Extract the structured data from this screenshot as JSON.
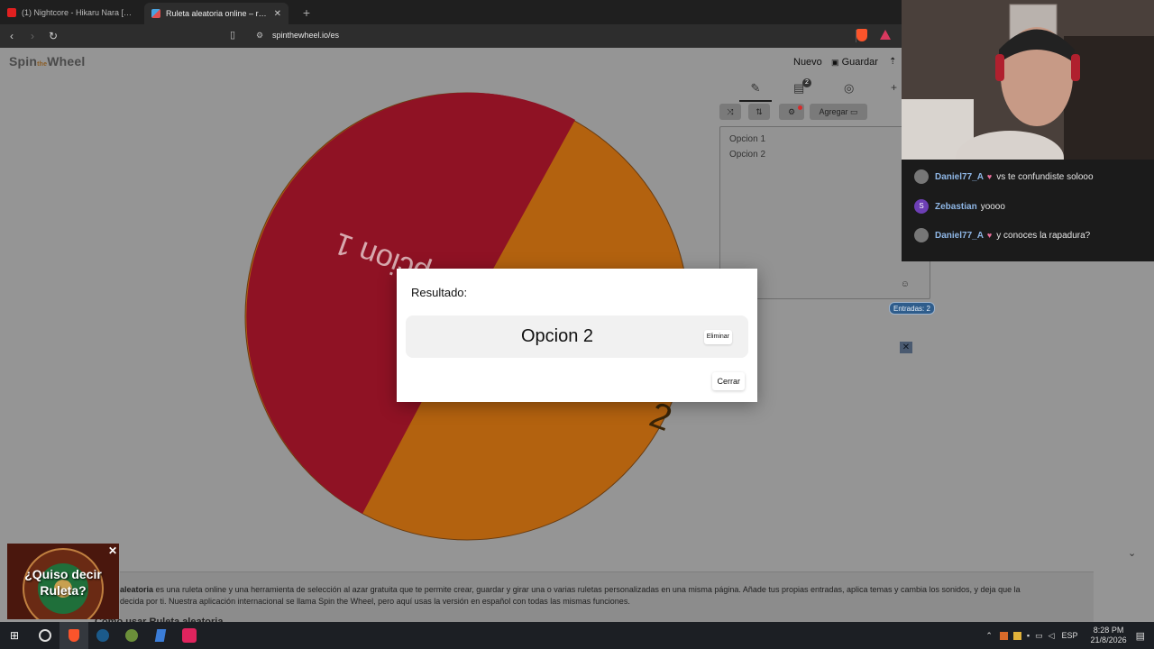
{
  "browser": {
    "tabs": [
      {
        "title": "(1) Nightcore - Hikaru Nara [Shig",
        "color": "#e02020"
      },
      {
        "title": "Ruleta aleatoria online – ruleta d",
        "color": "#4aa3e0"
      }
    ],
    "new_tab": "+",
    "url": "spinthewheel.io/es"
  },
  "page": {
    "logo_main": "Spin",
    "logo_accent": "the",
    "logo_end": "Wheel",
    "menu": {
      "new": "Nuevo",
      "save": "Guardar"
    },
    "editor_tabs": {
      "entries_badge": "2"
    },
    "tools": {
      "add": "Agregar"
    },
    "entries": [
      "Opcion 1",
      "Opcion 2"
    ],
    "entries_count": "Entradas: 2",
    "wheel": {
      "slices": [
        {
          "label": "Opcion 1",
          "color": "#8f1224"
        },
        {
          "label": "Opcion 2",
          "color": "#b3620f"
        }
      ],
      "visible_label_1": "Opcion 1",
      "visible_label_2": "2"
    },
    "description_bold": "aleatoria",
    "description_rest": " es una ruleta online y una herramienta de selección al azar gratuita que te permite crear, guardar y girar una o varias ruletas personalizadas en una misma página. Añade tus propias entradas, aplica temas y cambia los sonidos, y deja que la",
    "description_line2": "decida por ti. Nuestra aplicación internacional se llama Spin the Wheel, pero aquí usas la versión en español con todas las mismas funciones.",
    "subheading": "Cómo usar Ruleta aleatoria"
  },
  "modal": {
    "title": "Resultado:",
    "result": "Opcion 2",
    "delete_label": "Eliminar",
    "close_label": "Cerrar"
  },
  "chat": [
    {
      "user": "Daniel77_A",
      "badge": "♥",
      "message": "vs te confundiste solooo",
      "avatar_color": "#777777"
    },
    {
      "user": "Zebastian",
      "badge": "",
      "message": "yoooo",
      "avatar_color": "#6d3fb5",
      "initial": "S"
    },
    {
      "user": "Daniel77_A",
      "badge": "♥",
      "message": "y conoces la rapadura?",
      "avatar_color": "#777777"
    }
  ],
  "ad": {
    "text": "¿Quiso decir Ruleta?",
    "close": "✕"
  },
  "taskbar": {
    "lang": "ESP",
    "time": "8:28 PM",
    "date": "21/8/2026"
  }
}
